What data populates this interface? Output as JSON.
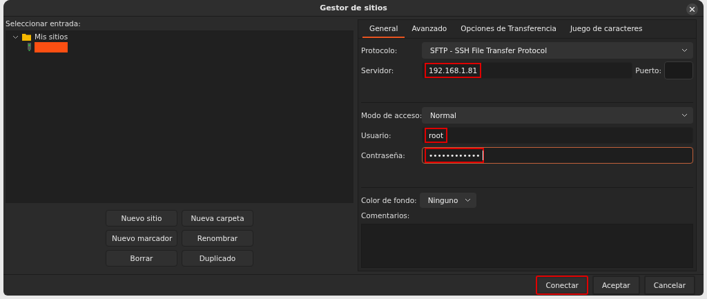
{
  "window": {
    "title": "Gestor de sitios"
  },
  "left": {
    "label": "Seleccionar entrada:",
    "tree": [
      {
        "label": "Mis sitios",
        "expanded": true,
        "children": [
          {
            "redacted": true
          }
        ]
      }
    ],
    "buttons": [
      {
        "label": "Nuevo sitio"
      },
      {
        "label": "Nueva carpeta"
      },
      {
        "label": "Nuevo marcador"
      },
      {
        "label": "Renombrar"
      },
      {
        "label": "Borrar"
      },
      {
        "label": "Duplicado"
      }
    ]
  },
  "tabs": [
    {
      "label": "General",
      "selected": true
    },
    {
      "label": "Avanzado",
      "selected": false
    },
    {
      "label": "Opciones de Transferencia",
      "selected": false
    },
    {
      "label": "Juego de caracteres",
      "selected": false
    }
  ],
  "form": {
    "protocol": {
      "label": "Protocolo:",
      "value": "SFTP - SSH File Transfer Protocol"
    },
    "server": {
      "label": "Servidor:",
      "value": "192.168.1.81",
      "highlighted": true
    },
    "port": {
      "label": "Puerto:"
    },
    "access": {
      "label": "Modo de acceso:",
      "value": "Normal"
    },
    "user": {
      "label": "Usuario:",
      "value": "root",
      "highlighted": true
    },
    "password": {
      "label": "Contraseña:",
      "value": "••••••••••••",
      "highlighted": true,
      "focused": true
    },
    "bgcolor": {
      "label": "Color de fondo:",
      "value": "Ninguno"
    },
    "comments": {
      "label": "Comentarios:"
    }
  },
  "footer": [
    {
      "label": "Conectar",
      "highlighted": true
    },
    {
      "label": "Aceptar",
      "highlighted": false
    },
    {
      "label": "Cancelar",
      "highlighted": false
    }
  ]
}
